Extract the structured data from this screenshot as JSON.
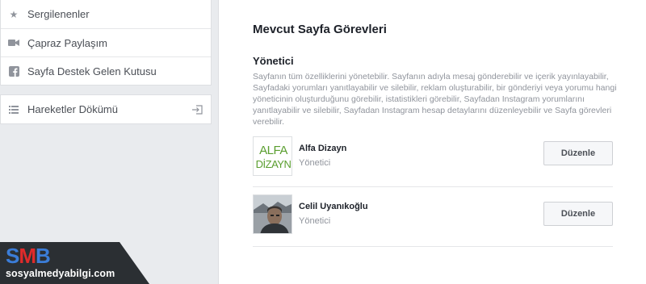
{
  "sidebar": {
    "items": [
      {
        "label": "Sergilenenler",
        "icon": "star-icon"
      },
      {
        "label": "Çapraz Paylaşım",
        "icon": "video-camera-icon"
      },
      {
        "label": "Sayfa Destek Gelen Kutusu",
        "icon": "facebook-icon"
      }
    ],
    "activity_log": {
      "label": "Hareketler Dökümü",
      "icon": "list-icon",
      "action_icon": "export-icon"
    }
  },
  "main": {
    "title": "Mevcut Sayfa Görevleri",
    "role": {
      "title": "Yönetici",
      "description": "Sayfanın tüm özelliklerini yönetebilir. Sayfanın adıyla mesaj gönderebilir ve içerik yayınlayabilir, Sayfadaki yorumları yanıtlayabilir ve silebilir, reklam oluşturabilir, bir gönderiyi veya yorumu hangi yöneticinin oluşturduğunu görebilir, istatistikleri görebilir, Sayfadan Instagram yorumlarını yanıtlayabilir ve silebilir, Sayfadan Instagram hesap detaylarını düzenleyebilir ve Sayfa görevleri verebilir."
    },
    "people": [
      {
        "name": "Alfa Dizayn",
        "role": "Yönetici",
        "button": "Düzenle",
        "avatar_text": [
          "ALFA",
          "DİZAYN"
        ]
      },
      {
        "name": "Celil Uyanıkoğlu",
        "role": "Yönetici",
        "button": "Düzenle"
      }
    ]
  },
  "watermark": {
    "logo": {
      "s": "S",
      "m": "M",
      "b": "B"
    },
    "url": "sosyalmedyabilgi.com"
  },
  "colors": {
    "brand_green": "#5a9e2f",
    "logo_blue": "#3b7dd8",
    "logo_red": "#e02b2b"
  }
}
